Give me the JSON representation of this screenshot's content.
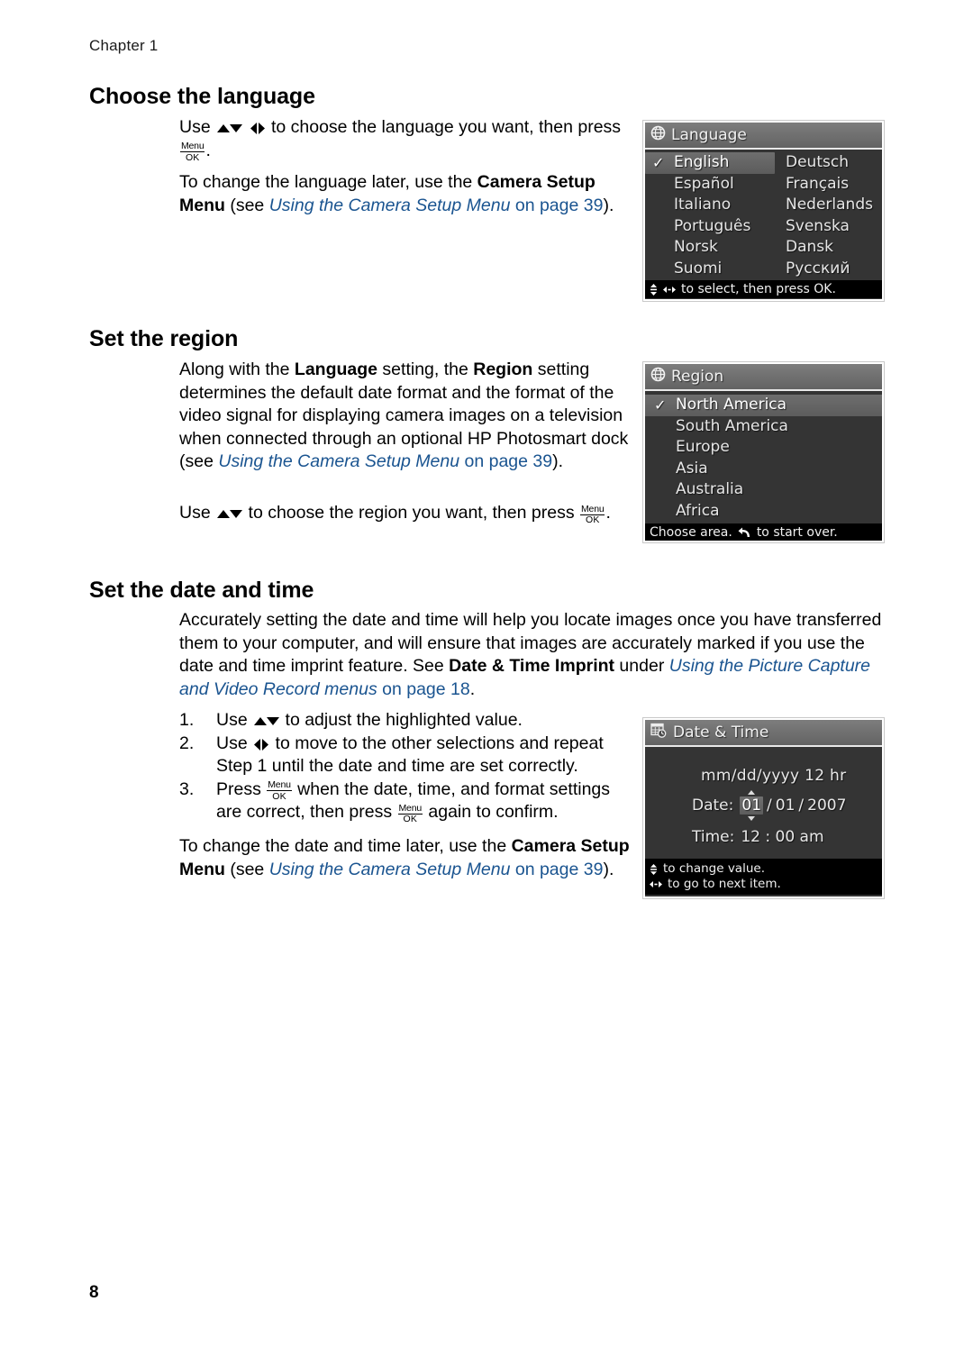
{
  "header": {
    "chapter": "Chapter 1"
  },
  "folio": {
    "page_number": "8"
  },
  "colors": {
    "link": "#1a5490",
    "lcd_body": "#343434",
    "lcd_titlebar": "#6b6b6b",
    "lcd_hintbar": "#000000",
    "lcd_highlight": "#666666"
  },
  "sections": {
    "language": {
      "heading": "Choose the language",
      "p1_a": "Use ",
      "p1_b": " to choose the language you want, then press ",
      "p1_c": ".",
      "p2_a": "To change the language later, use the ",
      "p2_bold1": "Camera Setup Menu",
      "p2_b": " (see ",
      "p2_link_italic": "Using the Camera Setup Menu",
      "p2_link_plain": " on page 39",
      "p2_c": ")."
    },
    "region": {
      "heading": "Set the region",
      "p1_a": "Along with the ",
      "p1_bold1": "Language",
      "p1_b": " setting, the ",
      "p1_bold2": "Region",
      "p1_c": " setting determines the default date format and the format of the video signal for displaying camera images on a television when connected through an optional HP Photosmart dock (see ",
      "p1_link_italic": "Using the Camera Setup Menu",
      "p1_link_plain": " on page 39",
      "p1_d": ").",
      "p2_a": "Use ",
      "p2_b": " to choose the region you want, then press ",
      "p2_c": "."
    },
    "datetime": {
      "heading": "Set the date and time",
      "intro_a": "Accurately setting the date and time will help you locate images once you have transferred them to your computer, and will ensure that images are accurately marked if you use the date and time imprint feature. See ",
      "intro_bold": "Date & Time Imprint",
      "intro_b": " under ",
      "intro_link_italic": "Using the Picture Capture and Video Record menus",
      "intro_link_plain": " on page 18",
      "intro_c": ".",
      "steps": [
        {
          "num": "1.",
          "a": "Use ",
          "glyph": "up-down-arrows",
          "b": " to adjust the highlighted value.",
          "c": ""
        },
        {
          "num": "2.",
          "a": "Use ",
          "glyph": "left-right-arrows",
          "b": " to move to the other selections and repeat Step 1 until the date and time are set correctly.",
          "c": ""
        },
        {
          "num": "3.",
          "a": "Press ",
          "glyph": "menu-ok",
          "b": " when the date, time, and format settings are correct, then press ",
          "c": " again to confirm."
        }
      ],
      "last_a": "To change the date and time later, use the ",
      "last_bold": "Camera Setup Menu",
      "last_b": " (see ",
      "last_link_italic": "Using the Camera Setup Menu",
      "last_link_plain": " on page 39",
      "last_c": ")."
    }
  },
  "lcd_language": {
    "title": "Language",
    "title_icon": "globe-icon",
    "column_left": [
      "English",
      "Español",
      "Italiano",
      "Português",
      "Norsk",
      "Suomi"
    ],
    "column_right": [
      "Deutsch",
      "Français",
      "Nederlands",
      "Svenska",
      "Dansk",
      "Русский"
    ],
    "selected": "English",
    "check_glyph": "✓",
    "hint": "to select, then press OK."
  },
  "lcd_region": {
    "title": "Region",
    "title_icon": "globe-icon",
    "items": [
      "North America",
      "South America",
      "Europe",
      "Asia",
      "Australia",
      "Africa"
    ],
    "selected": "North America",
    "check_glyph": "✓",
    "hint_a": "Choose area.",
    "hint_b": "to start over."
  },
  "lcd_datetime": {
    "title": "Date & Time",
    "title_icon": "calendar-clock-icon",
    "format": "mm/dd/yyyy  12 hr",
    "date_label": "Date:",
    "date_month": "01",
    "date_sep1": "/",
    "date_day": "01",
    "date_sep2": "/",
    "date_year": "2007",
    "time_label": "Time:",
    "time_value": "12 : 00  am",
    "hint_line1": "to change value.",
    "hint_line2": "to go to next item."
  }
}
